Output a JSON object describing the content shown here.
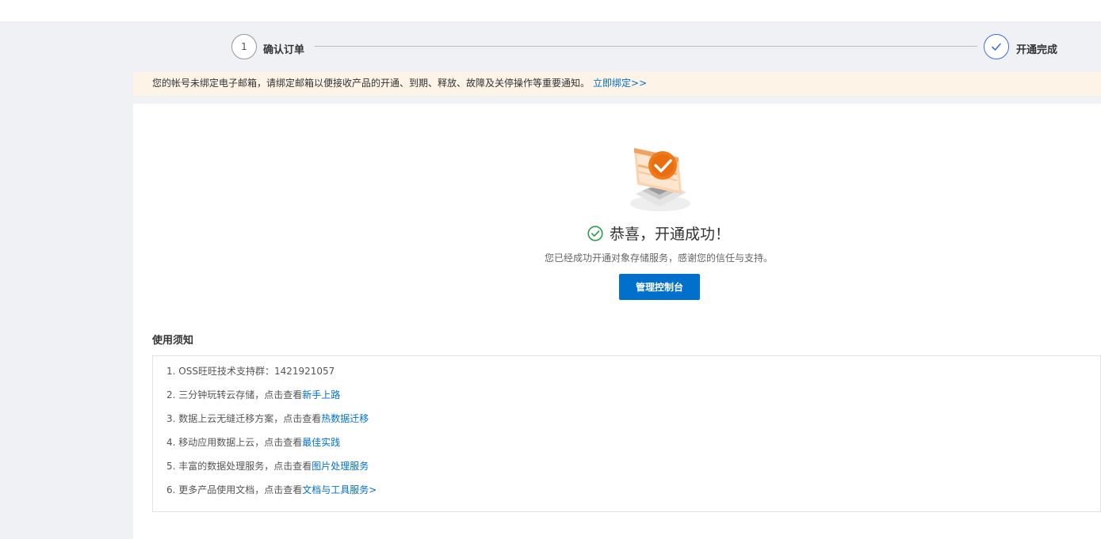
{
  "steps": [
    {
      "number": "1",
      "label": "确认订单"
    },
    {
      "label": "开通完成"
    }
  ],
  "notice": {
    "text": "您的帐号未绑定电子邮箱，请绑定邮箱以便接收产品的开通、到期、释放、故障及关停操作等重要通知。",
    "link": "立即绑定>>"
  },
  "success": {
    "title": "恭喜，开通成功！",
    "subtitle": "您已经成功开通对象存储服务，感谢您的信任与支持。",
    "button": "管理控制台"
  },
  "notes": {
    "title": "使用须知",
    "items": [
      {
        "text": "1. OSS旺旺技术支持群：1421921057",
        "link": ""
      },
      {
        "text": "2. 三分钟玩转云存储，点击查看",
        "link": "新手上路"
      },
      {
        "text": "3. 数据上云无缝迁移方案，点击查看",
        "link": "热数据迁移"
      },
      {
        "text": "4. 移动应用数据上云，点击查看",
        "link": "最佳实践"
      },
      {
        "text": "5. 丰富的数据处理服务，点击查看",
        "link": "图片处理服务"
      },
      {
        "text": "6. 更多产品使用文档，点击查看",
        "link": "文档与工具服务>"
      }
    ]
  },
  "colors": {
    "primary": "#0070cc",
    "notice_bg": "#fdf3e6",
    "success_green": "#2a9d4a",
    "step_active": "#3d6fe0",
    "illustration_orange": "#f07a1a"
  },
  "icons": {
    "step_done": "check-icon",
    "success": "check-circle-icon",
    "illustration": "monitor-check-illustration"
  }
}
